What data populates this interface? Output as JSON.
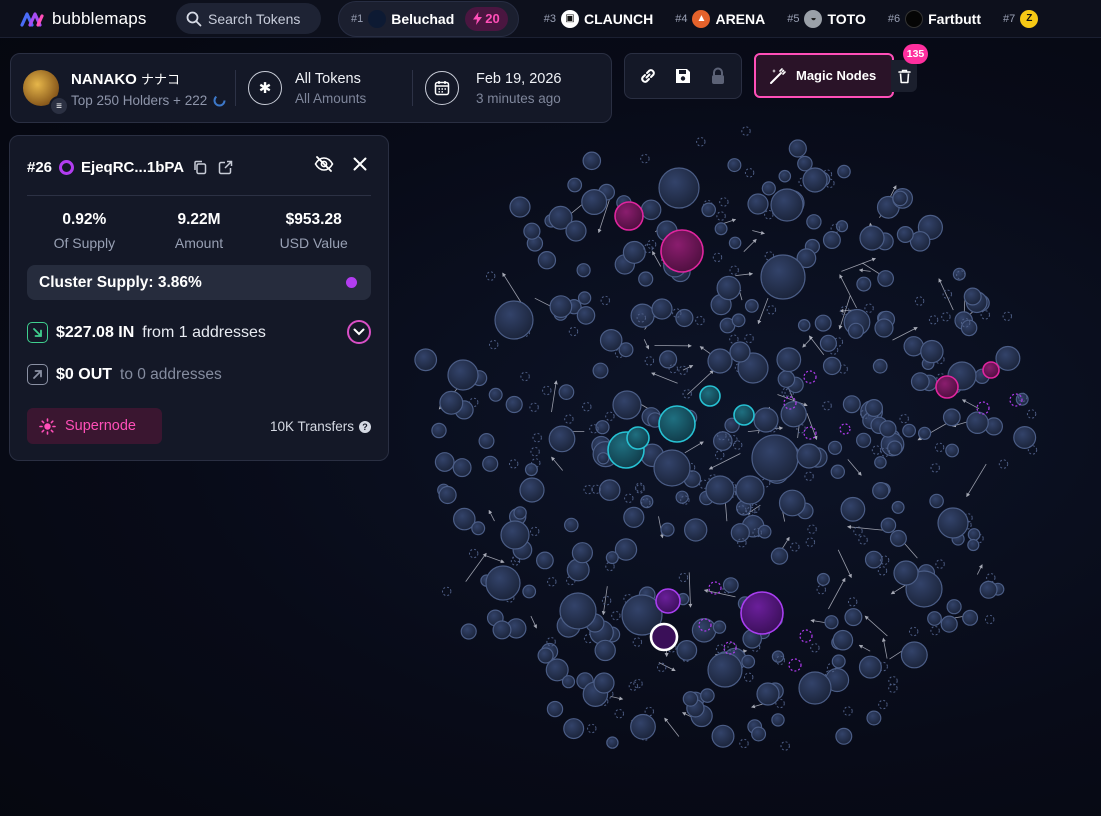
{
  "app": {
    "name": "bubblemaps"
  },
  "search": {
    "placeholder": "Search Tokens"
  },
  "trending": [
    {
      "rank": "#1",
      "name": "Beluchad",
      "boost": "20",
      "icon": "moon-icon",
      "color": "#3a7bd5"
    },
    {
      "rank": "#3",
      "name": "CLAUNCH",
      "icon": "claunch-logo-icon",
      "color": "#ffffff"
    },
    {
      "rank": "#4",
      "name": "ARENA",
      "icon": "arena-logo-icon",
      "color": "#e4622b"
    },
    {
      "rank": "#5",
      "name": "TOTO",
      "icon": "toto-logo-icon",
      "color": "#9aa0a8"
    },
    {
      "rank": "#6",
      "name": "Fartbutt",
      "icon": "fartbutt-logo-icon",
      "color": "#111111"
    },
    {
      "rank": "#7",
      "name": "",
      "icon": "z-logo-icon",
      "color": "#f6c915"
    }
  ],
  "token": {
    "name": "NANAKO",
    "alias": "ナナコ",
    "holders": "Top 250 Holders + 222"
  },
  "filters": {
    "tokens": "All Tokens",
    "amounts": "All Amounts"
  },
  "snapshot": {
    "date": "Feb 19, 2026",
    "ago": "3 minutes ago"
  },
  "toolbar": {
    "magic_label": "Magic Nodes",
    "magic_count": "135"
  },
  "detail": {
    "rank": "#26",
    "address": "EjeqRC...1bPA",
    "supply_pct": "0.92%",
    "supply_label": "Of Supply",
    "amount": "9.22M",
    "amount_label": "Amount",
    "usd": "$953.28",
    "usd_label": "USD Value",
    "cluster_supply": "Cluster Supply: 3.86%",
    "in_amount": "$227.08 IN",
    "in_from": "from 1 addresses",
    "out_amount": "$0 OUT",
    "out_to": "to 0 addresses",
    "supernode_label": "Supernode",
    "transfers": "10K Transfers"
  },
  "colors": {
    "accent_pink": "#ff4fb8",
    "accent_purple": "#b23df0",
    "bubble_default": "#243149",
    "bubble_cyan": "#1fb7c9",
    "bubble_magenta": "#d01f9b"
  }
}
